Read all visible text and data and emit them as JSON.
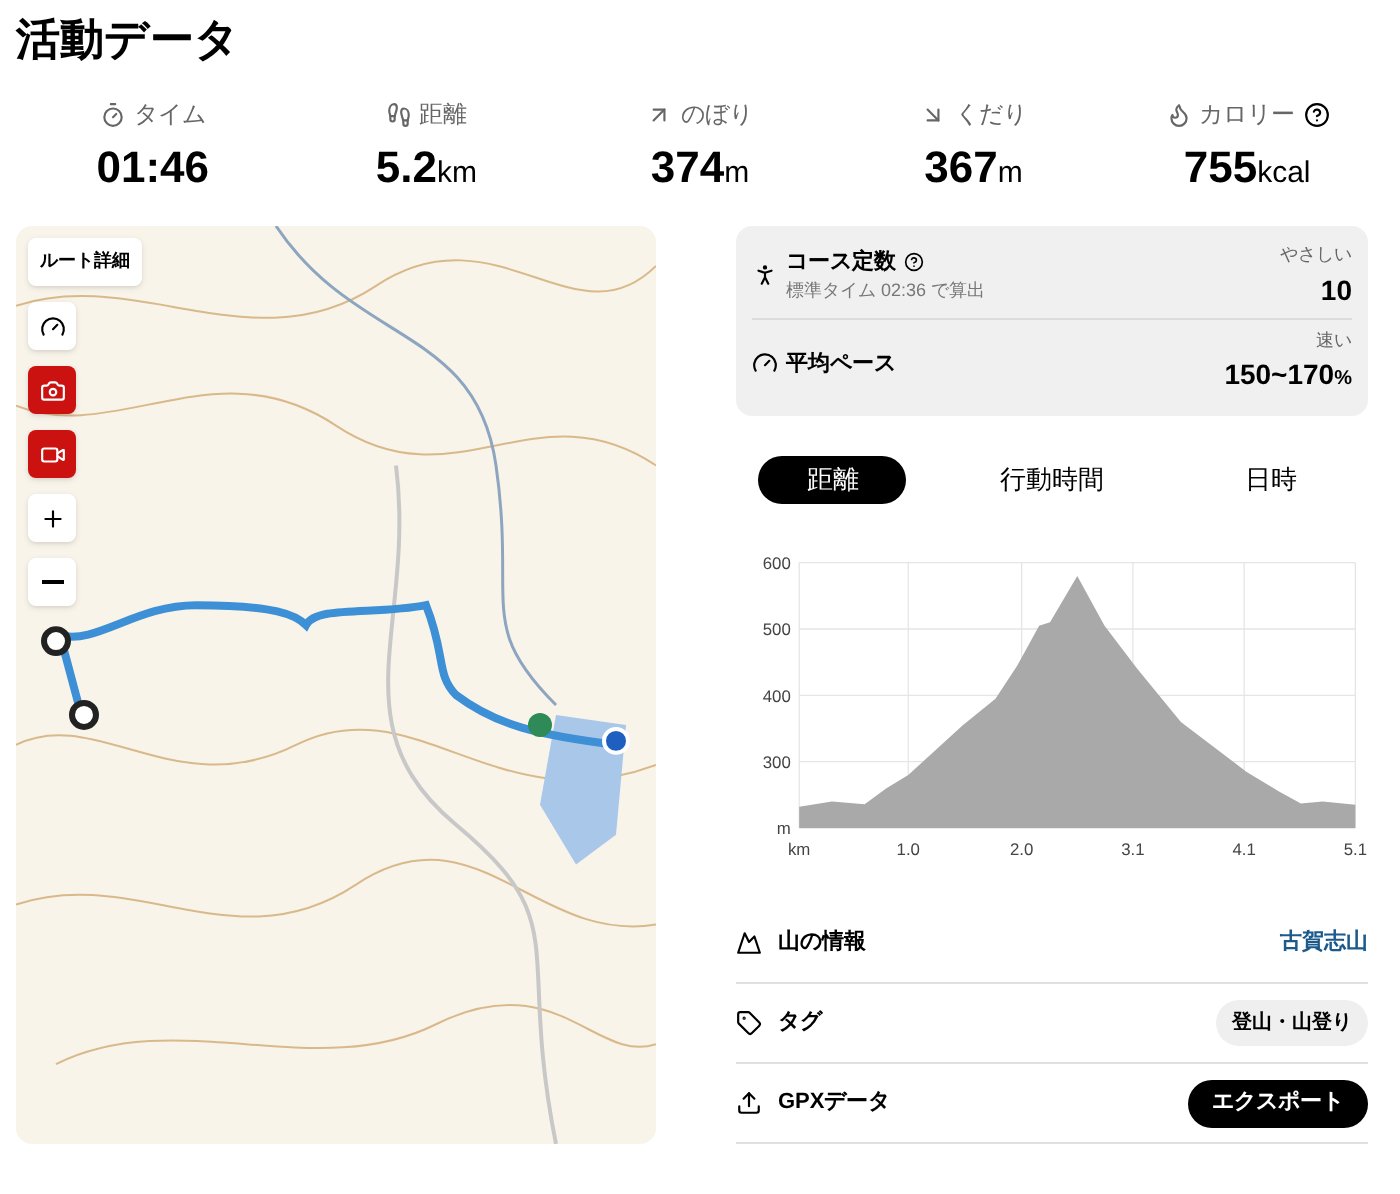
{
  "title": "活動データ",
  "stats": [
    {
      "kind": "time",
      "label": "タイム",
      "value": "01:46"
    },
    {
      "kind": "walk",
      "label": "距離",
      "value": "5.2",
      "unit": "km"
    },
    {
      "kind": "up",
      "label": "のぼり",
      "value": "374",
      "unit": "m"
    },
    {
      "kind": "down",
      "label": "くだり",
      "value": "367",
      "unit": "m"
    },
    {
      "kind": "fire",
      "label": "カロリー",
      "value": "755",
      "unit": "kcal",
      "help": true
    }
  ],
  "map": {
    "route_button": "ルート詳細",
    "controls": [
      {
        "kind": "gauge",
        "active": false
      },
      {
        "kind": "camera",
        "active": true
      },
      {
        "kind": "video",
        "active": true
      },
      {
        "kind": "plus",
        "active": false
      },
      {
        "kind": "minus",
        "active": false
      }
    ]
  },
  "summary": [
    {
      "kind": "hiker",
      "label": "コース定数",
      "help": true,
      "note": "標準タイム 02:36 で算出",
      "rating": "やさしい",
      "value": "10"
    },
    {
      "kind": "gauge",
      "label": "平均ペース",
      "rating": "速い",
      "value": "150~170",
      "unit": "%"
    }
  ],
  "tabs": [
    {
      "label": "距離",
      "selected": true
    },
    {
      "label": "行動時間",
      "selected": false
    },
    {
      "label": "日時",
      "selected": false
    }
  ],
  "chart_data": {
    "type": "area",
    "x": [
      0,
      0.3,
      0.6,
      0.8,
      1.0,
      1.5,
      1.8,
      2.0,
      2.2,
      2.3,
      2.55,
      2.8,
      3.1,
      3.5,
      4.1,
      4.4,
      4.6,
      4.8,
      5.1
    ],
    "grid": true,
    "series": [
      {
        "color": "#a9a9a9",
        "values": [
          232,
          240,
          236,
          260,
          280,
          355,
          395,
          445,
          505,
          510,
          580,
          505,
          440,
          360,
          285,
          255,
          237,
          240,
          235
        ]
      }
    ],
    "xlim": [
      0,
      5.1
    ],
    "ylim": [
      200,
      600
    ],
    "xticks": [
      {
        "value": 0,
        "label": "km"
      },
      {
        "value": 1.0,
        "label": "1.0"
      },
      {
        "value": 2.04,
        "label": "2.0"
      },
      {
        "value": 3.06,
        "label": "3.1"
      },
      {
        "value": 4.08,
        "label": "4.1"
      },
      {
        "value": 5.1,
        "label": "5.1"
      }
    ],
    "yticks": [
      {
        "value": 200,
        "label": "m"
      },
      300,
      400,
      500,
      600
    ]
  },
  "info": [
    {
      "kind": "mountain",
      "label": "山の情報",
      "value": "古賀志山"
    },
    {
      "kind": "tag",
      "label": "タグ",
      "value": "登山・山登り"
    },
    {
      "kind": "upload",
      "label": "GPXデータ",
      "value": "エクスポート"
    }
  ]
}
